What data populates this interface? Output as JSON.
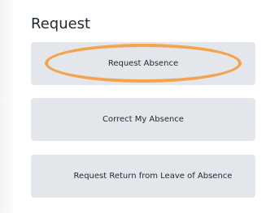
{
  "section": {
    "title": "Request"
  },
  "buttons": [
    {
      "label": "Request Absence"
    },
    {
      "label": "Correct My Absence"
    },
    {
      "label": "Request Return from Leave of Absence"
    }
  ],
  "annotation": {
    "highlight_color": "#f4a44f",
    "shape": "ellipse"
  },
  "colors": {
    "button_background": "#e3e6ea",
    "text": "#1f2933"
  }
}
